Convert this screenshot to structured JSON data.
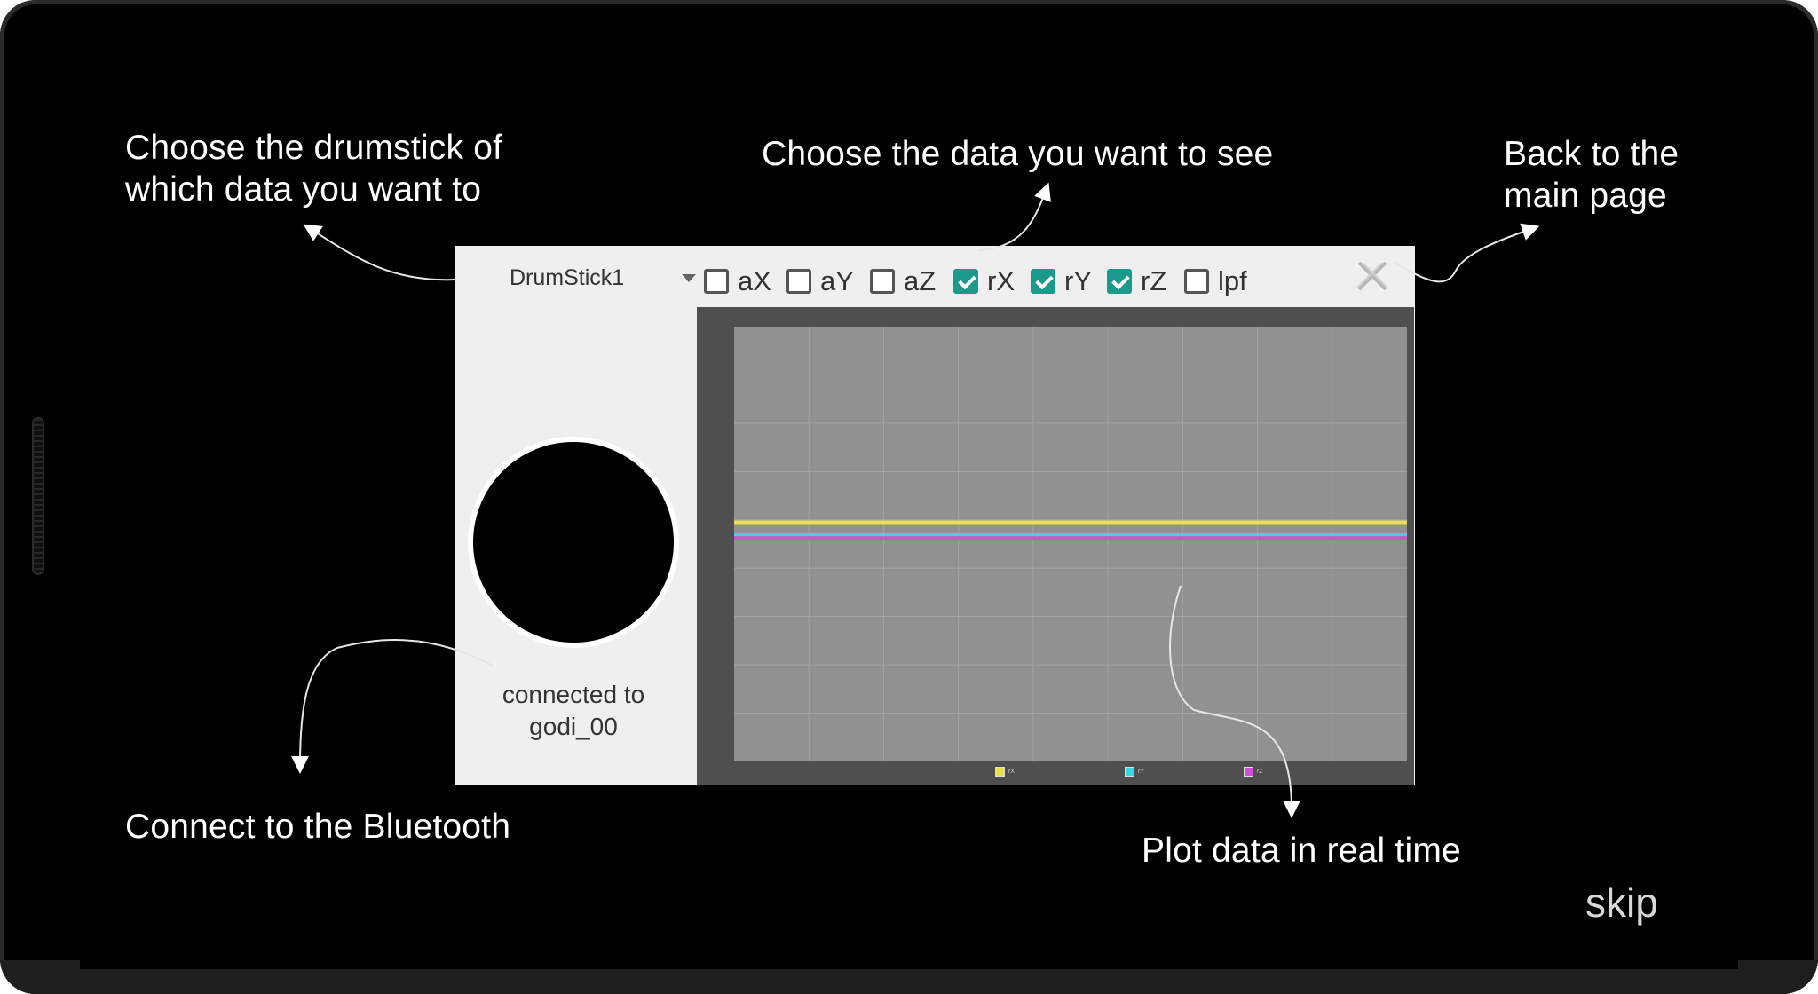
{
  "annotations": {
    "drumstick": "Choose the drumstick of\nwhich data you want to",
    "data": "Choose the data you want to see",
    "back": "Back to the\nmain page",
    "bluetooth": "Connect to the Bluetooth",
    "plot": "Plot data in real time"
  },
  "skip_label": "skip",
  "app": {
    "dropdown": {
      "selected": "DrumStick1"
    },
    "checkboxes": [
      {
        "label": "aX",
        "checked": false
      },
      {
        "label": "aY",
        "checked": false
      },
      {
        "label": "aZ",
        "checked": false
      },
      {
        "label": "rX",
        "checked": true
      },
      {
        "label": "rY",
        "checked": true
      },
      {
        "label": "rZ",
        "checked": true
      },
      {
        "label": "lpf",
        "checked": false
      }
    ],
    "connection_status": "connected to\ngodi_00"
  },
  "colors": {
    "check_accent": "#199a8c",
    "series_rX": "#e8e34a",
    "series_rY": "#35d7e0",
    "series_rZ": "#d24fd8"
  },
  "chart_data": {
    "type": "line",
    "series": [
      {
        "name": "rX",
        "color": "#e8e34a",
        "values": [
          0.9,
          0.9
        ]
      },
      {
        "name": "rY",
        "color": "#35d7e0",
        "values": [
          0.4,
          0.4
        ]
      },
      {
        "name": "rZ",
        "color": "#d24fd8",
        "values": [
          0.25,
          0.25
        ]
      }
    ],
    "ylim": [
      -9,
      9
    ],
    "grid": true
  }
}
